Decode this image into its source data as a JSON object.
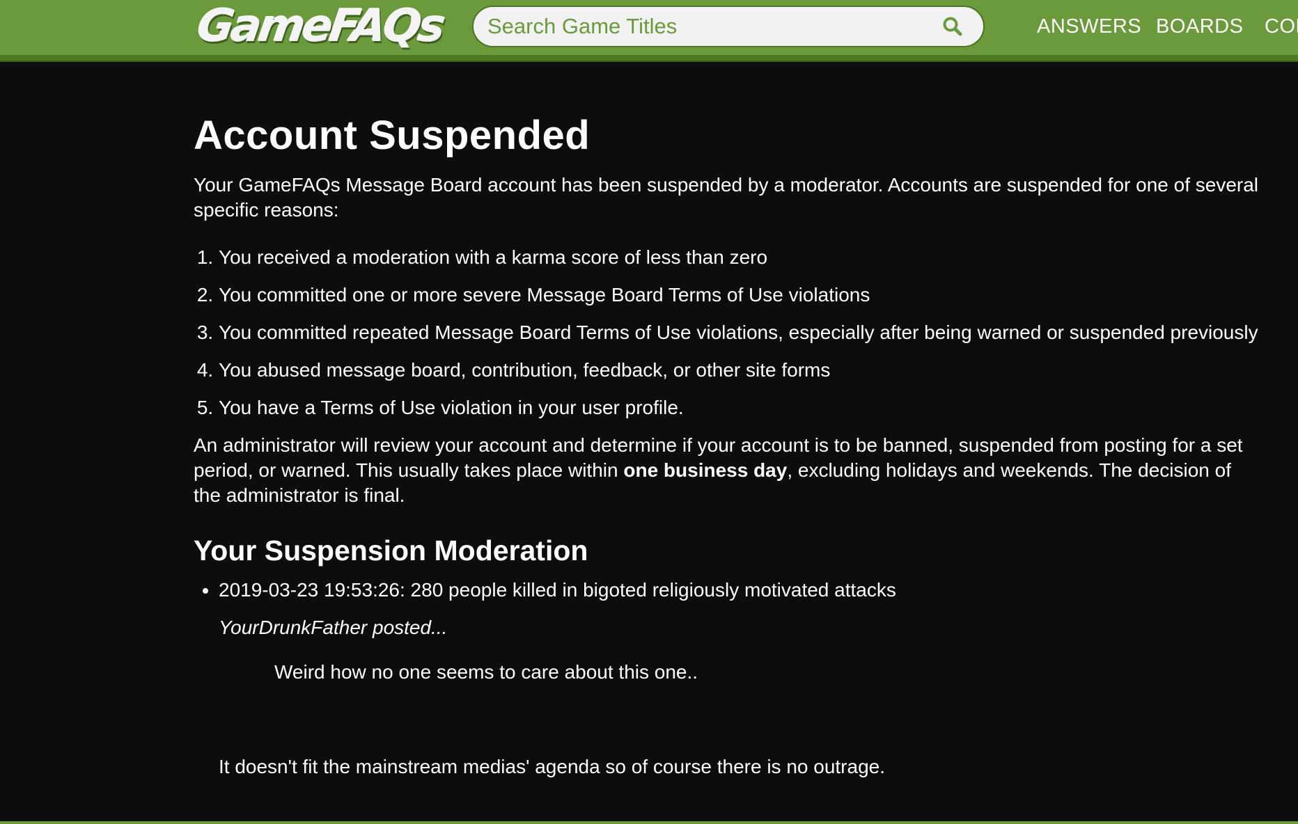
{
  "header": {
    "logo_text": "GameFAQs",
    "search": {
      "placeholder": "Search Game Titles"
    },
    "nav": {
      "answers": "ANSWERS",
      "boards": "BOARDS",
      "community": "COM"
    },
    "colors": {
      "bar": "#6a9a3b",
      "bar_border": "#4e7a26"
    }
  },
  "main": {
    "title": "Account Suspended",
    "intro": "Your GameFAQs Message Board account has been suspended by a moderator. Accounts are suspended for one of several specific reasons:",
    "reasons": [
      "You received a moderation with a karma score of less than zero",
      "You committed one or more severe Message Board Terms of Use violations",
      "You committed repeated Message Board Terms of Use violations, especially after being warned or suspended previously",
      "You abused message board, contribution, feedback, or other site forms",
      "You have a Terms of Use violation in your user profile."
    ],
    "admin_note": {
      "before": "An administrator will review your account and determine if your account is to be banned, suspended from posting for a set period, or warned. This usually takes place within ",
      "bold": "one business day",
      "after": ", excluding holidays and weekends. The decision of the administrator is final."
    },
    "moderation_section": {
      "title": "Your Suspension Moderation",
      "entry": "2019-03-23 19:53:26: 280 people killed in bigoted religiously motivated attacks",
      "poster": "YourDrunkFather posted...",
      "quote_line_1": "Weird how no one seems to care about this one..",
      "quote_line_2": "It doesn't fit the mainstream medias' agenda so of course there is no outrage."
    }
  },
  "icons": {
    "search": "search-icon"
  },
  "colors": {
    "background": "#0d0d0d",
    "text": "#ffffff",
    "accent": "#6a9a3b"
  }
}
